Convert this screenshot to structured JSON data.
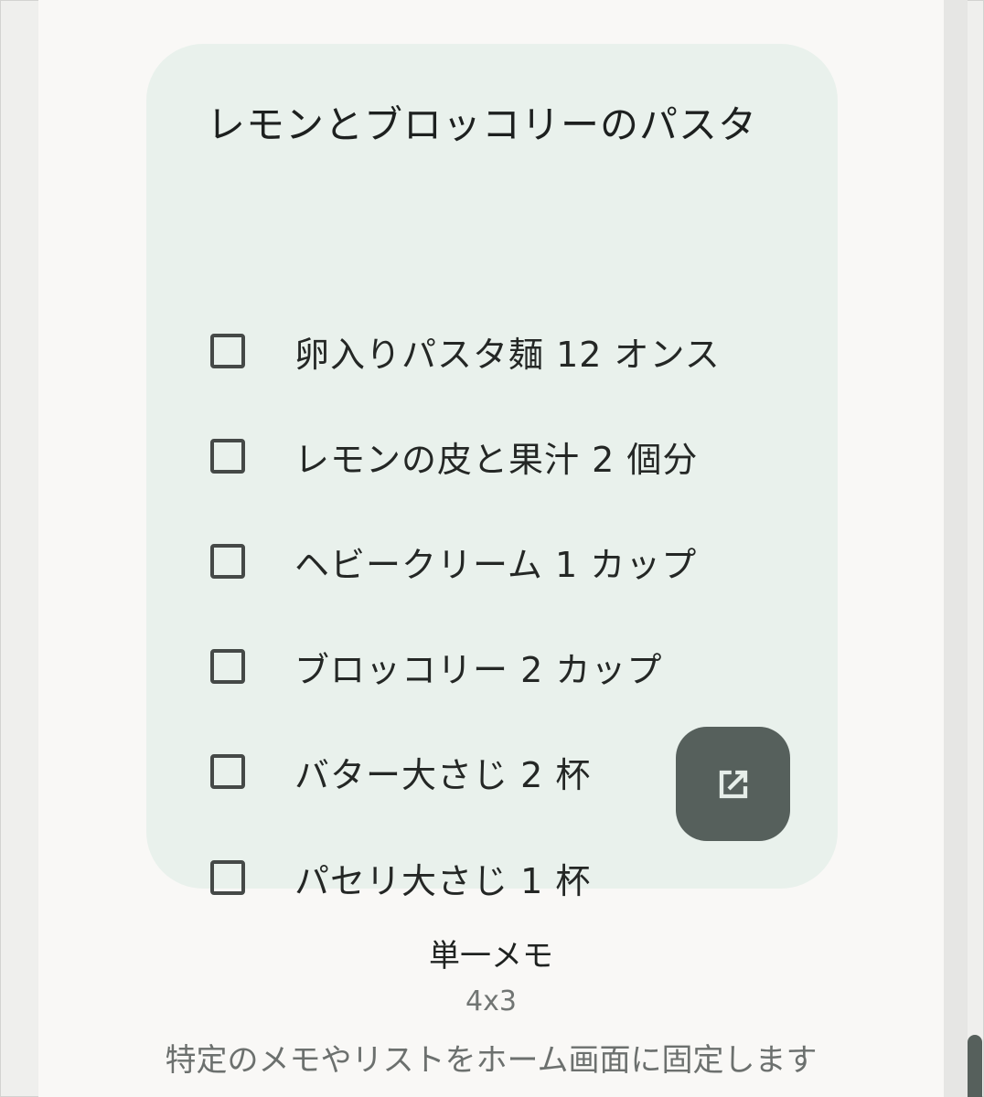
{
  "widget": {
    "title": "レモンとブロッコリーのパスタ",
    "items": [
      {
        "label": "卵入りパスタ麺 12 オンス",
        "checked": false
      },
      {
        "label": "レモンの皮と果汁 2 個分",
        "checked": false
      },
      {
        "label": "ヘビークリーム 1 カップ",
        "checked": false
      },
      {
        "label": "ブロッコリー 2 カップ",
        "checked": false
      },
      {
        "label": "バター大さじ 2 杯",
        "checked": false
      },
      {
        "label": "パセリ大さじ 1 杯",
        "checked": false
      }
    ],
    "open_button_icon": "open-in-new-icon"
  },
  "caption": {
    "name": "単一メモ",
    "size": "4x3",
    "description": "特定のメモやリストをホーム画面に固定します"
  },
  "colors": {
    "card_background": "#e9f1ec",
    "button_background": "#56605c",
    "page_background": "#f9f8f6"
  }
}
